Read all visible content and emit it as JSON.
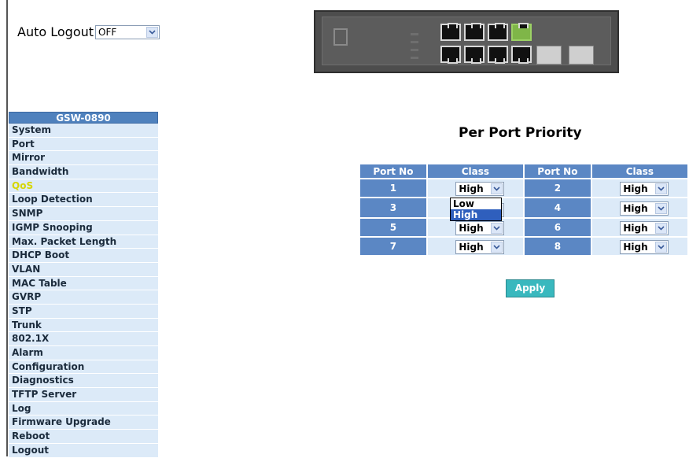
{
  "auto_logout": {
    "label": "Auto Logout",
    "value": "OFF"
  },
  "device": {
    "name": "switch-front-panel"
  },
  "sidebar": {
    "header": "GSW-0890",
    "items": [
      {
        "label": "System"
      },
      {
        "label": "Port"
      },
      {
        "label": "Mirror"
      },
      {
        "label": "Bandwidth"
      },
      {
        "label": "QoS",
        "active": true
      },
      {
        "label": "Loop Detection"
      },
      {
        "label": "SNMP"
      },
      {
        "label": "IGMP Snooping"
      },
      {
        "label": "Max. Packet Length"
      },
      {
        "label": "DHCP Boot"
      },
      {
        "label": "VLAN"
      },
      {
        "label": "MAC Table"
      },
      {
        "label": "GVRP"
      },
      {
        "label": "STP"
      },
      {
        "label": "Trunk"
      },
      {
        "label": "802.1X"
      },
      {
        "label": "Alarm"
      },
      {
        "label": "Configuration"
      },
      {
        "label": "Diagnostics"
      },
      {
        "label": "TFTP Server"
      },
      {
        "label": "Log"
      },
      {
        "label": "Firmware Upgrade"
      },
      {
        "label": "Reboot"
      },
      {
        "label": "Logout"
      }
    ]
  },
  "main": {
    "title": "Per Port Priority",
    "table": {
      "headers": [
        "Port No",
        "Class",
        "Port No",
        "Class"
      ],
      "rows": [
        {
          "port_a": "1",
          "class_a": "High",
          "port_b": "2",
          "class_b": "High"
        },
        {
          "port_a": "3",
          "class_a": "",
          "port_b": "4",
          "class_b": "High"
        },
        {
          "port_a": "5",
          "class_a": "High",
          "port_b": "6",
          "class_b": "High"
        },
        {
          "port_a": "7",
          "class_a": "High",
          "port_b": "8",
          "class_b": "High"
        }
      ]
    },
    "dropdown": {
      "options": [
        "Low",
        "High"
      ],
      "highlighted": "High"
    },
    "apply_label": "Apply"
  },
  "colors": {
    "header_blue": "#5b87c4",
    "cell_light": "#dceaf8",
    "apply": "#39b8be",
    "active_item": "#d6d600"
  }
}
